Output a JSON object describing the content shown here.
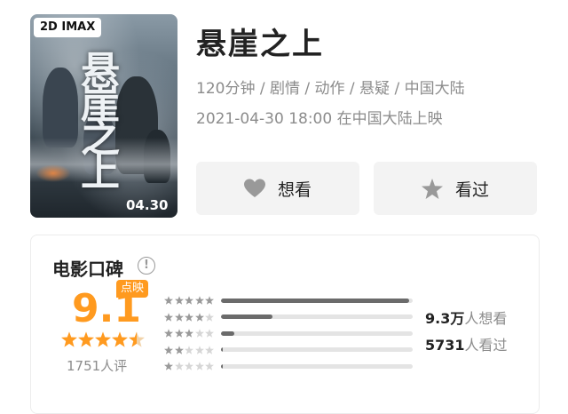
{
  "poster": {
    "badge": "2D IMAX",
    "title_art": "悬崖之上",
    "date_art": "04.30"
  },
  "movie": {
    "title": "悬崖之上",
    "meta": "120分钟 / 剧情 / 动作 / 悬疑 / 中国大陆",
    "release": "2021-04-30 18:00 在中国大陆上映"
  },
  "actions": {
    "want_label": "想看",
    "want_icon": "heart-icon",
    "seen_label": "看过",
    "seen_icon": "star-icon"
  },
  "rating": {
    "section_title": "电影口碑",
    "info_icon": "info-icon",
    "score": "9.1",
    "score_badge": "点映",
    "stars": 4.5,
    "rating_count": "1751人评",
    "accent_color": "#ff9a1f",
    "distribution": [
      {
        "stars": 5,
        "fraction": 0.98
      },
      {
        "stars": 4,
        "fraction": 0.27
      },
      {
        "stars": 3,
        "fraction": 0.07
      },
      {
        "stars": 2,
        "fraction": 0.01
      },
      {
        "stars": 1,
        "fraction": 0.01
      }
    ],
    "want_count": "9.3万",
    "want_suffix": "人想看",
    "seen_count": "5731",
    "seen_suffix": "人看过"
  }
}
